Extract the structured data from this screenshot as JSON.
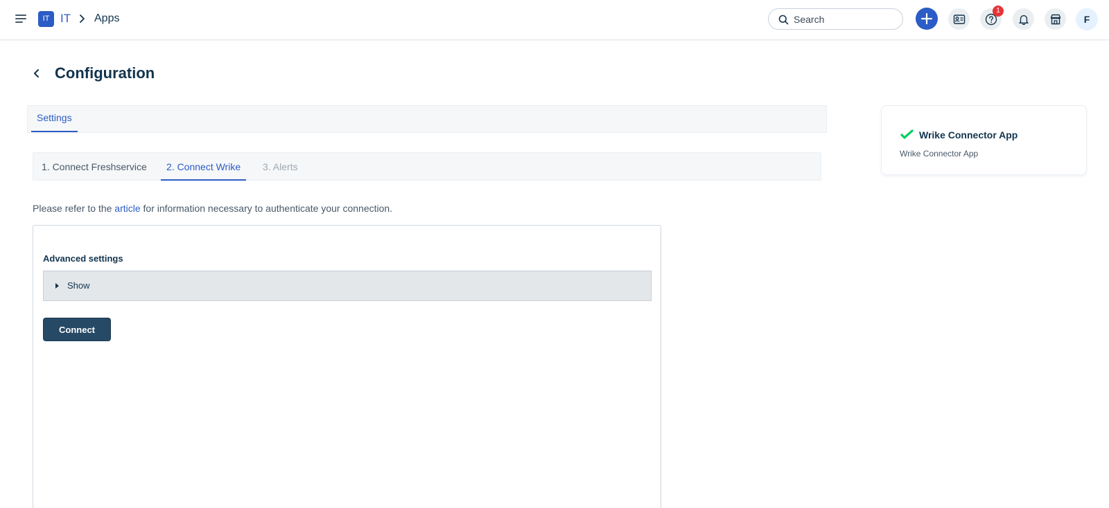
{
  "header": {
    "menu_icon": "hamburger-icon",
    "workspace_badge": "IT",
    "workspace_name": "IT",
    "breadcrumb_separator_icon": "chevron-right-icon",
    "current_page": "Apps",
    "search": {
      "placeholder": "Search",
      "icon": "search-icon"
    },
    "actions": [
      {
        "name": "add-new-button",
        "icon": "plus-icon"
      },
      {
        "name": "service-catalog-button",
        "icon": "id-card-icon"
      },
      {
        "name": "help-button",
        "icon": "question-mark-icon"
      },
      {
        "name": "notifications-button",
        "icon": "bell-icon"
      },
      {
        "name": "marketplace-button",
        "icon": "store-icon"
      }
    ],
    "help_badge_count": "1",
    "avatar_initial": "F"
  },
  "page": {
    "back_icon": "chevron-left-icon",
    "title": "Configuration",
    "tabs": [
      {
        "label": "Settings",
        "active": true
      }
    ],
    "steps": [
      {
        "label": "1. Connect Freshservice",
        "state": "completed"
      },
      {
        "label": "2. Connect Wrike",
        "state": "active"
      },
      {
        "label": "3. Alerts",
        "state": "disabled"
      }
    ],
    "info": {
      "before": "Please refer to the ",
      "link": "article",
      "after": " for information necessary to authenticate your connection."
    },
    "form": {
      "advanced_label": "Advanced settings",
      "accordion_label": "Show",
      "connect_label": "Connect"
    }
  },
  "app_card": {
    "logo_icon": "wrike-check-icon",
    "name": "Wrike Connector App",
    "subtitle": "Wrike Connector App"
  },
  "colors": {
    "primary": "#2c5cc5",
    "connect_button": "#264966",
    "wrike_green": "#08cf65",
    "badge_red": "#e43538"
  }
}
